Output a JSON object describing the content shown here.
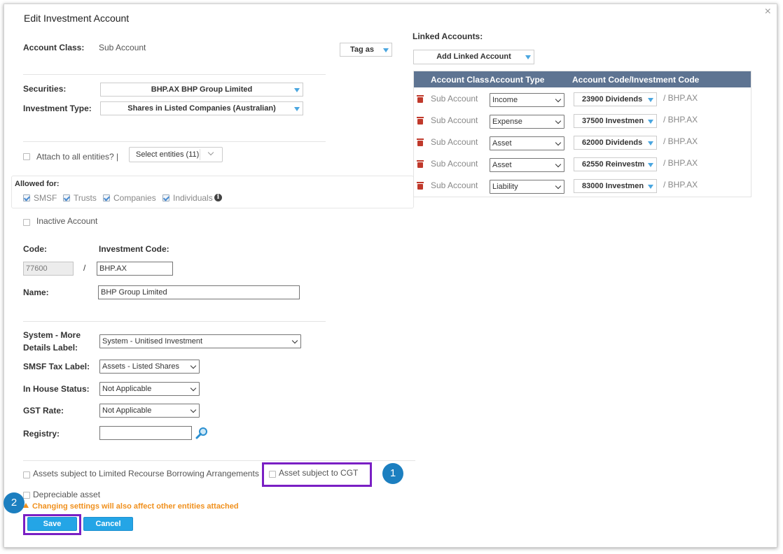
{
  "dialog": {
    "title": "Edit Investment Account",
    "close": "×"
  },
  "account_class": {
    "label": "Account Class:",
    "value": "Sub Account"
  },
  "tag_as": "Tag as",
  "securities": {
    "label": "Securities:",
    "value": "BHP.AX BHP Group Limited"
  },
  "investment_type": {
    "label": "Investment Type:",
    "value": "Shares in Listed Companies (Australian)"
  },
  "attach_all": {
    "label": "Attach to all entities?",
    "separator": "|",
    "select_entities": "Select entities (11)"
  },
  "allowed_for": {
    "label": "Allowed for:",
    "options": [
      "SMSF",
      "Trusts",
      "Companies",
      "Individuals"
    ]
  },
  "inactive_account": "Inactive Account",
  "code": {
    "label": "Code:",
    "value": "77600",
    "slash": "/"
  },
  "investment_code": {
    "label": "Investment Code:",
    "value": "BHP.AX"
  },
  "name": {
    "label": "Name:",
    "value": "BHP Group Limited"
  },
  "system_label": {
    "label_line1": "System - More",
    "label_line2": "Details Label:",
    "value": "System - Unitised Investment"
  },
  "smsf_tax_label": {
    "label": "SMSF Tax Label:",
    "value": "Assets - Listed Shares"
  },
  "in_house_status": {
    "label": "In House Status:",
    "value": "Not Applicable"
  },
  "gst_rate": {
    "label": "GST Rate:",
    "value": "Not Applicable"
  },
  "registry": {
    "label": "Registry:",
    "value": ""
  },
  "lrba": "Assets subject to Limited Recourse Borrowing Arrangements",
  "cgt": "Asset subject to CGT",
  "depreciable": "Depreciable asset",
  "warning": "Changing settings will also affect other entities attached",
  "buttons": {
    "save": "Save",
    "cancel": "Cancel"
  },
  "callouts": [
    "1",
    "2"
  ],
  "linked": {
    "title": "Linked Accounts:",
    "add_button": "Add Linked Account",
    "headers": [
      "Account Class",
      "Account Type",
      "Account Code/Investment Code"
    ],
    "rows": [
      {
        "class": "Sub Account",
        "type": "Income",
        "code": "23900 Dividends",
        "suffix": "/ BHP.AX"
      },
      {
        "class": "Sub Account",
        "type": "Expense",
        "code": "37500 Investmen",
        "suffix": "/ BHP.AX"
      },
      {
        "class": "Sub Account",
        "type": "Asset",
        "code": "62000 Dividends",
        "suffix": "/ BHP.AX"
      },
      {
        "class": "Sub Account",
        "type": "Asset",
        "code": "62550 Reinvestm",
        "suffix": "/ BHP.AX"
      },
      {
        "class": "Sub Account",
        "type": "Liability",
        "code": "83000 Investmen",
        "suffix": "/ BHP.AX"
      }
    ]
  },
  "colors": {
    "accent": "#24a5e6",
    "highlight": "#7a1fc4",
    "badge": "#1c7fc0",
    "table_header": "#5e7492",
    "warning": "#f0901d"
  }
}
